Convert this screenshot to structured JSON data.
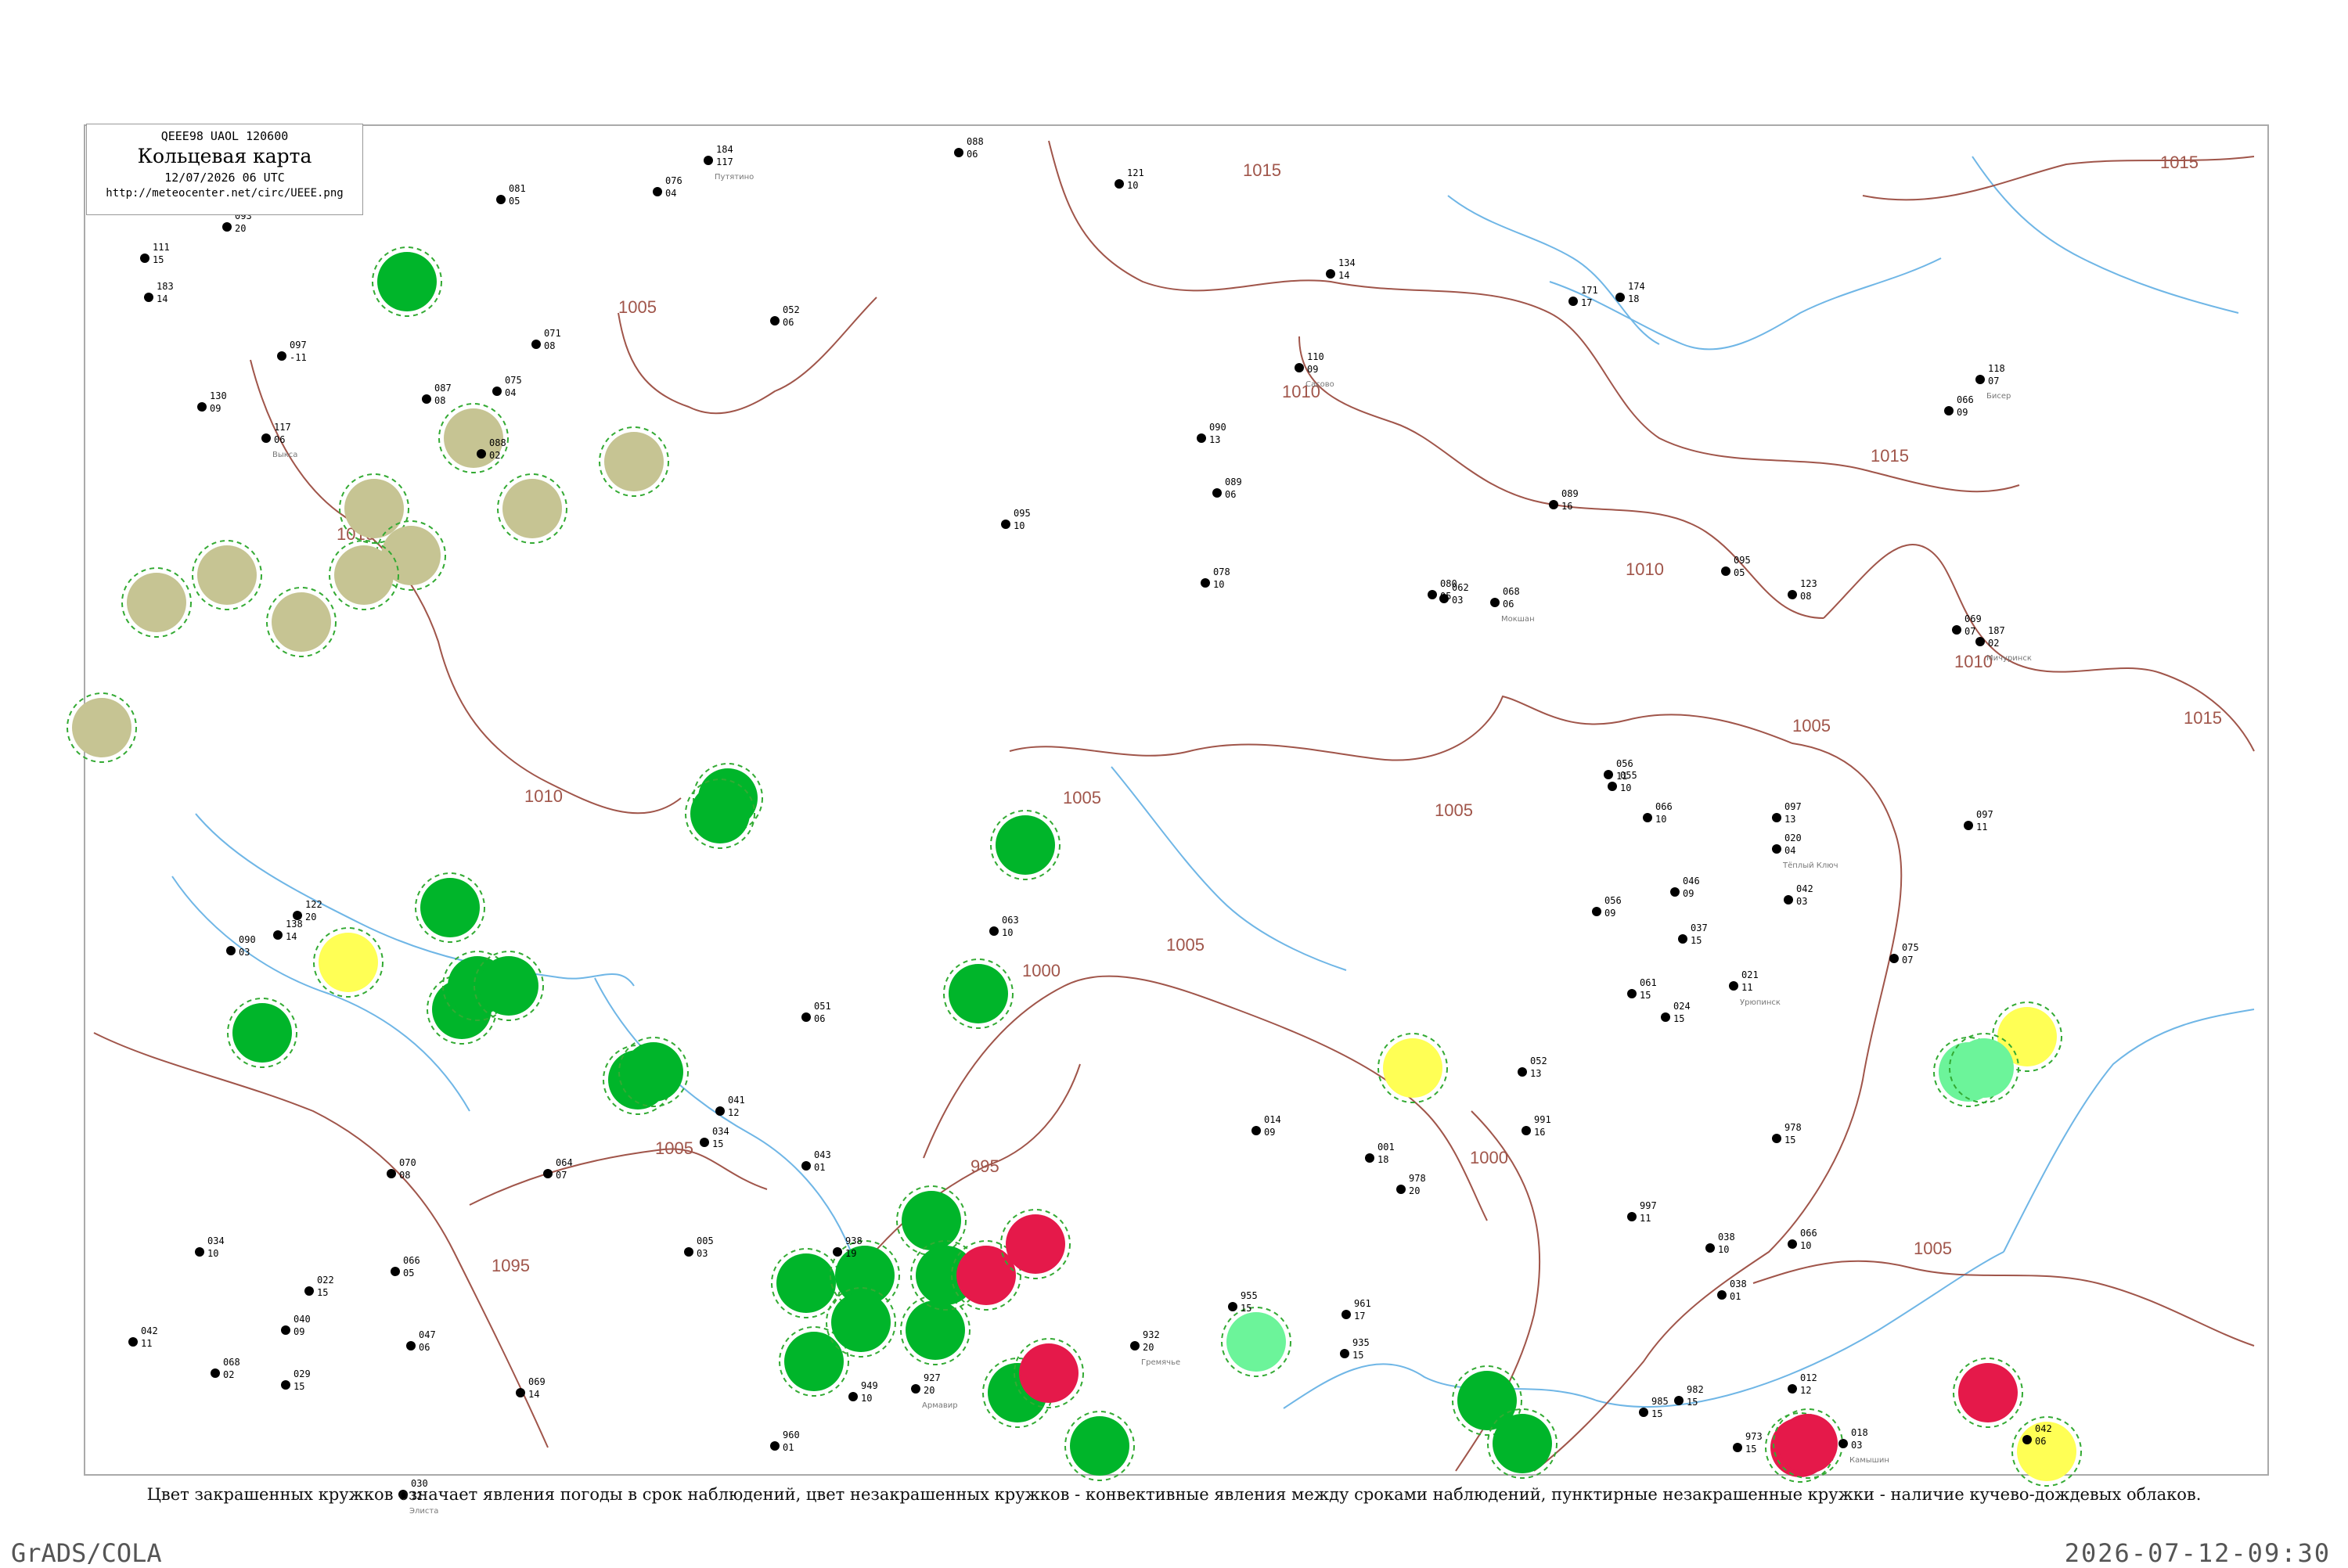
{
  "legend": {
    "code": "QEEE98  UAOL  120600",
    "title": "Кольцевая карта",
    "date": "12/07/2026 06 UTC",
    "url": "http://meteocenter.net/circ/UEEE.png"
  },
  "caption": "Цвет закрашенных кружков означает явления погоды в срок наблюдений, цвет незакрашенных кружков - конвективные явления между сроками наблюдений, пунктирные незакрашенные кружки - наличие кучево-дождевых облаков.",
  "footer": {
    "left": "GrADS/COLA",
    "right": "2026-07-12-09:30"
  },
  "isobars": [
    {
      "label": "1015"
    },
    {
      "label": "1015"
    },
    {
      "label": "1015"
    },
    {
      "label": "1015"
    },
    {
      "label": "1010"
    },
    {
      "label": "1010"
    },
    {
      "label": "1010"
    },
    {
      "label": "1010"
    },
    {
      "label": "1010"
    },
    {
      "label": "1010"
    },
    {
      "label": "1005"
    },
    {
      "label": "1005"
    },
    {
      "label": "1005"
    },
    {
      "label": "1005"
    },
    {
      "label": "1005"
    },
    {
      "label": "1005"
    },
    {
      "label": "1005"
    },
    {
      "label": "1000"
    },
    {
      "label": "1000"
    },
    {
      "label": "995"
    },
    {
      "label": "1095"
    }
  ],
  "colors": {
    "rain": "#00b52a",
    "fog": "#c6c493",
    "thunder": "#e5194a",
    "showers": "#ffff55",
    "drizzle": "#6cf49a",
    "cb_dashed": "#33aa33",
    "isobar": "#a0554a",
    "river": "#6fb6e6"
  },
  "stations": [
    {
      "p": "097",
      "t": "-11",
      "name": ""
    },
    {
      "p": "111",
      "t": "15",
      "name": ""
    },
    {
      "p": "183",
      "t": "14",
      "name": ""
    },
    {
      "p": "093",
      "t": "20",
      "name": ""
    },
    {
      "p": "130",
      "t": "09",
      "name": ""
    },
    {
      "p": "117",
      "t": "06",
      "name": "Выкса"
    },
    {
      "p": "081",
      "t": "05",
      "name": ""
    },
    {
      "p": "071",
      "t": "08",
      "name": ""
    },
    {
      "p": "087",
      "t": "08",
      "name": ""
    },
    {
      "p": "075",
      "t": "04",
      "name": ""
    },
    {
      "p": "088",
      "t": "02",
      "name": ""
    },
    {
      "p": "076",
      "t": "04",
      "name": ""
    },
    {
      "p": "184",
      "t": "117",
      "name": "Путятино"
    },
    {
      "p": "052",
      "t": "06",
      "name": ""
    },
    {
      "p": "088",
      "t": "06",
      "name": ""
    },
    {
      "p": "121",
      "t": "10",
      "name": ""
    },
    {
      "p": "134",
      "t": "14",
      "name": ""
    },
    {
      "p": "110",
      "t": "09",
      "name": "Сасово"
    },
    {
      "p": "171",
      "t": "17",
      "name": ""
    },
    {
      "p": "174",
      "t": "18",
      "name": ""
    },
    {
      "p": "066",
      "t": "09",
      "name": ""
    },
    {
      "p": "118",
      "t": "07",
      "name": "Бисер"
    },
    {
      "p": "187",
      "t": "02",
      "name": "Мичуринск"
    },
    {
      "p": "090",
      "t": "13",
      "name": ""
    },
    {
      "p": "089",
      "t": "06",
      "name": ""
    },
    {
      "p": "095",
      "t": "05",
      "name": ""
    },
    {
      "p": "089",
      "t": "16",
      "name": ""
    },
    {
      "p": "078",
      "t": "10",
      "name": ""
    },
    {
      "p": "080",
      "t": "05",
      "name": ""
    },
    {
      "p": "068",
      "t": "06",
      "name": "Мокшан"
    },
    {
      "p": "095",
      "t": "10",
      "name": ""
    },
    {
      "p": "123",
      "t": "08",
      "name": ""
    },
    {
      "p": "069",
      "t": "07",
      "name": ""
    },
    {
      "p": "005",
      "t": "03",
      "name": ""
    },
    {
      "p": "062",
      "t": "03",
      "name": ""
    },
    {
      "p": "056",
      "t": "11",
      "name": ""
    },
    {
      "p": "055",
      "t": "10",
      "name": ""
    },
    {
      "p": "066",
      "t": "10",
      "name": ""
    },
    {
      "p": "097",
      "t": "13",
      "name": ""
    },
    {
      "p": "020",
      "t": "04",
      "name": "Тёплый Ключ"
    },
    {
      "p": "042",
      "t": "03",
      "name": ""
    },
    {
      "p": "075",
      "t": "07",
      "name": ""
    },
    {
      "p": "097",
      "t": "11",
      "name": ""
    },
    {
      "p": "056",
      "t": "09",
      "name": ""
    },
    {
      "p": "046",
      "t": "09",
      "name": ""
    },
    {
      "p": "037",
      "t": "15",
      "name": ""
    },
    {
      "p": "021",
      "t": "11",
      "name": "Урюпинск"
    },
    {
      "p": "024",
      "t": "15",
      "name": ""
    },
    {
      "p": "061",
      "t": "15",
      "name": ""
    },
    {
      "p": "052",
      "t": "13",
      "name": ""
    },
    {
      "p": "991",
      "t": "16",
      "name": ""
    },
    {
      "p": "978",
      "t": "15",
      "name": ""
    },
    {
      "p": "997",
      "t": "11",
      "name": ""
    },
    {
      "p": "066",
      "t": "10",
      "name": ""
    },
    {
      "p": "038",
      "t": "10",
      "name": ""
    },
    {
      "p": "038",
      "t": "01",
      "name": ""
    },
    {
      "p": "012",
      "t": "12",
      "name": ""
    },
    {
      "p": "018",
      "t": "03",
      "name": "Камышин"
    },
    {
      "p": "042",
      "t": "06",
      "name": ""
    },
    {
      "p": "982",
      "t": "15",
      "name": ""
    },
    {
      "p": "985",
      "t": "15",
      "name": ""
    },
    {
      "p": "973",
      "t": "15",
      "name": ""
    },
    {
      "p": "961",
      "t": "17",
      "name": ""
    },
    {
      "p": "935",
      "t": "15",
      "name": ""
    },
    {
      "p": "955",
      "t": "15",
      "name": ""
    },
    {
      "p": "932",
      "t": "20",
      "name": "Гремячье"
    },
    {
      "p": "949",
      "t": "10",
      "name": ""
    },
    {
      "p": "927",
      "t": "20",
      "name": "Армавир"
    },
    {
      "p": "938",
      "t": "19",
      "name": ""
    },
    {
      "p": "960",
      "t": "01",
      "name": ""
    },
    {
      "p": "040",
      "t": "09",
      "name": ""
    },
    {
      "p": "069",
      "t": "14",
      "name": ""
    },
    {
      "p": "047",
      "t": "06",
      "name": ""
    },
    {
      "p": "030",
      "t": "12",
      "name": "Элиста"
    },
    {
      "p": "068",
      "t": "02",
      "name": ""
    },
    {
      "p": "042",
      "t": "11",
      "name": ""
    },
    {
      "p": "029",
      "t": "15",
      "name": ""
    },
    {
      "p": "034",
      "t": "10",
      "name": ""
    },
    {
      "p": "022",
      "t": "15",
      "name": ""
    },
    {
      "p": "066",
      "t": "05",
      "name": ""
    },
    {
      "p": "064",
      "t": "07",
      "name": ""
    },
    {
      "p": "070",
      "t": "08",
      "name": ""
    },
    {
      "p": "041",
      "t": "12",
      "name": ""
    },
    {
      "p": "034",
      "t": "15",
      "name": ""
    },
    {
      "p": "043",
      "t": "01",
      "name": ""
    },
    {
      "p": "014",
      "t": "09",
      "name": ""
    },
    {
      "p": "001",
      "t": "18",
      "name": ""
    },
    {
      "p": "978",
      "t": "20",
      "name": ""
    },
    {
      "p": "063",
      "t": "10",
      "name": ""
    },
    {
      "p": "051",
      "t": "06",
      "name": ""
    },
    {
      "p": "090",
      "t": "03",
      "name": ""
    },
    {
      "p": "138",
      "t": "14",
      "name": ""
    },
    {
      "p": "122",
      "t": "20",
      "name": ""
    }
  ],
  "rings": [
    {
      "type": "rain"
    },
    {
      "type": "rain"
    },
    {
      "type": "rain"
    },
    {
      "type": "rain"
    },
    {
      "type": "rain"
    },
    {
      "type": "rain"
    },
    {
      "type": "rain"
    },
    {
      "type": "rain"
    },
    {
      "type": "rain"
    },
    {
      "type": "rain"
    },
    {
      "type": "rain"
    },
    {
      "type": "rain"
    },
    {
      "type": "rain"
    },
    {
      "type": "rain"
    },
    {
      "type": "rain"
    },
    {
      "type": "rain"
    },
    {
      "type": "rain"
    },
    {
      "type": "rain"
    },
    {
      "type": "rain"
    },
    {
      "type": "rain"
    },
    {
      "type": "rain"
    },
    {
      "type": "rain"
    },
    {
      "type": "rain"
    },
    {
      "type": "fog"
    },
    {
      "type": "fog"
    },
    {
      "type": "fog"
    },
    {
      "type": "fog"
    },
    {
      "type": "fog"
    },
    {
      "type": "fog"
    },
    {
      "type": "fog"
    },
    {
      "type": "fog"
    },
    {
      "type": "fog"
    },
    {
      "type": "fog"
    },
    {
      "type": "thunder"
    },
    {
      "type": "thunder"
    },
    {
      "type": "thunder"
    },
    {
      "type": "thunder"
    },
    {
      "type": "thunder"
    },
    {
      "type": "thunder"
    },
    {
      "type": "showers"
    },
    {
      "type": "showers"
    },
    {
      "type": "showers"
    },
    {
      "type": "showers"
    },
    {
      "type": "drizzle"
    },
    {
      "type": "drizzle"
    },
    {
      "type": "drizzle"
    }
  ]
}
